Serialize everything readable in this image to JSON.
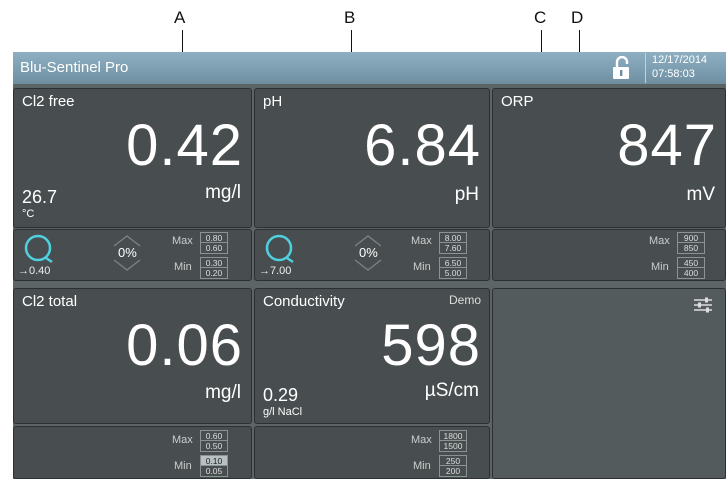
{
  "callouts": {
    "a": "A",
    "b": "B",
    "c": "C",
    "d": "D"
  },
  "header": {
    "title": "Blu-Sentinel Pro",
    "date": "12/17/2014",
    "time": "07:58:03",
    "lock_icon": "unlock-icon"
  },
  "tiles": {
    "cl2free": {
      "title": "Cl2 free",
      "value": "0.42",
      "unit": "mg/l",
      "secondary_value": "26.7",
      "secondary_unit": "°C"
    },
    "ph": {
      "title": "pH",
      "value": "6.84",
      "unit": "pH"
    },
    "orp": {
      "title": "ORP",
      "value": "847",
      "unit": "mV"
    },
    "cl2total": {
      "title": "Cl2 total",
      "value": "0.06",
      "unit": "mg/l"
    },
    "conductivity": {
      "title": "Conductivity",
      "badge": "Demo",
      "value": "598",
      "unit": "µS/cm",
      "secondary_value": "0.29",
      "secondary_unit": "g/l NaCl"
    }
  },
  "controls": {
    "cl2free": {
      "setpoint": "→0.40",
      "output": "0%",
      "max_label": "Max",
      "min_label": "Min",
      "max": [
        "0.80",
        "0.60"
      ],
      "min": [
        "0.30",
        "0.20"
      ]
    },
    "ph": {
      "setpoint": "→7.00",
      "output": "0%",
      "max_label": "Max",
      "min_label": "Min",
      "max": [
        "8.00",
        "7.60"
      ],
      "min": [
        "6.50",
        "5.00"
      ]
    },
    "orp": {
      "max_label": "Max",
      "min_label": "Min",
      "max": [
        "900",
        "850"
      ],
      "min": [
        "450",
        "400"
      ]
    },
    "cl2total": {
      "max_label": "Max",
      "min_label": "Min",
      "max": [
        "0.60",
        "0.50"
      ],
      "min": [
        "0.10",
        "0.05"
      ]
    },
    "conductivity": {
      "max_label": "Max",
      "min_label": "Min",
      "max": [
        "1800",
        "1500"
      ],
      "min": [
        "250",
        "200"
      ]
    }
  },
  "icons": {
    "settings": "sliders-icon",
    "ring": "controller-ring-icon",
    "arrows": "up-down-arrows-icon"
  },
  "colors": {
    "titlebar": "#7f9fb1",
    "tile": "#484e4f",
    "accent": "#4fd0e0",
    "background": "#5c6465"
  }
}
